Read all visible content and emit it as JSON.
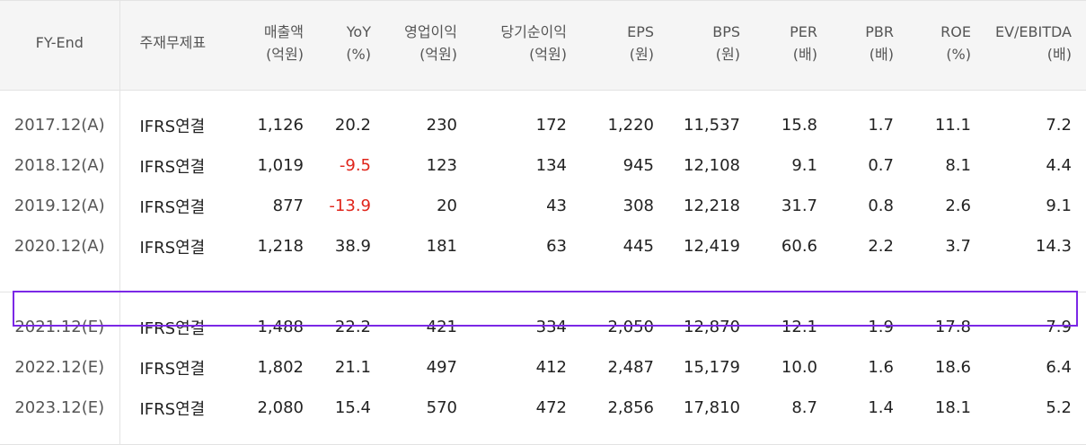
{
  "headers": [
    {
      "label": "FY-End",
      "unit": ""
    },
    {
      "label": "주재무제표",
      "unit": ""
    },
    {
      "label": "매출액",
      "unit": "(억원)"
    },
    {
      "label": "YoY",
      "unit": "(%)"
    },
    {
      "label": "영업이익",
      "unit": "(억원)"
    },
    {
      "label": "당기순이익",
      "unit": "(억원)"
    },
    {
      "label": "EPS",
      "unit": "(원)"
    },
    {
      "label": "BPS",
      "unit": "(원)"
    },
    {
      "label": "PER",
      "unit": "(배)"
    },
    {
      "label": "PBR",
      "unit": "(배)"
    },
    {
      "label": "ROE",
      "unit": "(%)"
    },
    {
      "label": "EV/EBITDA",
      "unit": "(배)"
    }
  ],
  "actual_rows": [
    [
      "2017.12(A)",
      "IFRS연결",
      "1,126",
      "20.2",
      "230",
      "172",
      "1,220",
      "11,537",
      "15.8",
      "1.7",
      "11.1",
      "7.2"
    ],
    [
      "2018.12(A)",
      "IFRS연결",
      "1,019",
      "-9.5",
      "123",
      "134",
      "945",
      "12,108",
      "9.1",
      "0.7",
      "8.1",
      "4.4"
    ],
    [
      "2019.12(A)",
      "IFRS연결",
      "877",
      "-13.9",
      "20",
      "43",
      "308",
      "12,218",
      "31.7",
      "0.8",
      "2.6",
      "9.1"
    ],
    [
      "2020.12(A)",
      "IFRS연결",
      "1,218",
      "38.9",
      "181",
      "63",
      "445",
      "12,419",
      "60.6",
      "2.2",
      "3.7",
      "14.3"
    ]
  ],
  "estimate_rows": [
    [
      "2021.12(E)",
      "IFRS연결",
      "1,488",
      "22.2",
      "421",
      "334",
      "2,050",
      "12,870",
      "12.1",
      "1.9",
      "17.8",
      "7.9"
    ],
    [
      "2022.12(E)",
      "IFRS연결",
      "1,802",
      "21.1",
      "497",
      "412",
      "2,487",
      "15,179",
      "10.0",
      "1.6",
      "18.6",
      "6.4"
    ],
    [
      "2023.12(E)",
      "IFRS연결",
      "2,080",
      "15.4",
      "570",
      "472",
      "2,856",
      "17,810",
      "8.7",
      "1.4",
      "18.1",
      "5.2"
    ]
  ],
  "colors": {
    "negative": "#e0251b",
    "highlight_border": "#7b28e6",
    "header_bg": "#f5f5f5"
  }
}
